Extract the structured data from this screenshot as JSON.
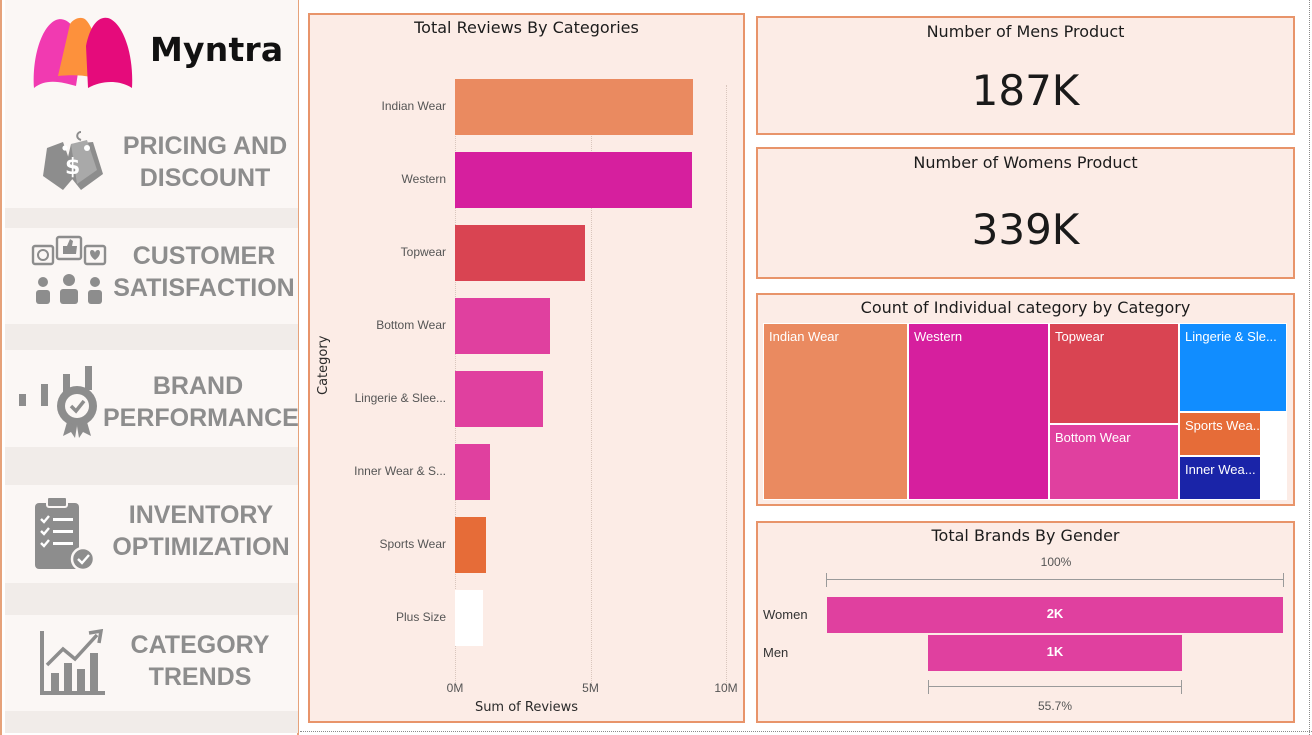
{
  "brand": {
    "name": "Myntra",
    "logo_colors": [
      "#f13ab1",
      "#fd913c",
      "#e50b7b"
    ]
  },
  "sidebar": {
    "items": [
      {
        "line1": "PRICING AND",
        "line2": "DISCOUNT",
        "icon": "price-tag-icon"
      },
      {
        "line1": "CUSTOMER",
        "line2": "SATISFACTION",
        "icon": "customer-feedback-icon"
      },
      {
        "line1": "BRAND",
        "line2": "PERFORMANCE",
        "icon": "brand-award-icon"
      },
      {
        "line1": "INVENTORY",
        "line2": "OPTIMIZATION",
        "icon": "clipboard-check-icon"
      },
      {
        "line1": "CATEGORY",
        "line2": "TRENDS",
        "icon": "trend-chart-icon"
      }
    ],
    "label_color": "#8d8d8d"
  },
  "cards": {
    "mens": {
      "title": "Number of Mens Product",
      "value": "187K"
    },
    "womens": {
      "title": "Number of Womens Product",
      "value": "339K"
    }
  },
  "chart_data": [
    {
      "type": "bar",
      "orientation": "horizontal",
      "title": "Total Reviews By Categories",
      "xlabel": "Sum of Reviews",
      "ylabel": "Category",
      "categories": [
        "Indian Wear",
        "Western",
        "Topwear",
        "Bottom Wear",
        "Lingerie & Slee...",
        "Inner Wear & S...",
        "Sports Wear",
        "Plus Size"
      ],
      "values": [
        8.8,
        8.75,
        4.8,
        3.5,
        3.25,
        1.3,
        1.15,
        1.05
      ],
      "colors": [
        "#ea8a60",
        "#d61f9e",
        "#d94452",
        "#e0409f",
        "#e0409f",
        "#e0409f",
        "#e66c38",
        "#ffffff"
      ],
      "x_ticks": [
        "0M",
        "5M",
        "10M"
      ],
      "xlim": [
        0,
        10
      ],
      "unit": "M",
      "grid": true
    },
    {
      "type": "treemap",
      "title": "Count of Individual category by Category",
      "items": [
        {
          "label": "Indian Wear",
          "color": "#ea8a60"
        },
        {
          "label": "Western",
          "color": "#d61f9e"
        },
        {
          "label": "Topwear",
          "color": "#d94452"
        },
        {
          "label": "Bottom Wear",
          "color": "#e0409f"
        },
        {
          "label": "Lingerie & Sle...",
          "color": "#118dff"
        },
        {
          "label": "Sports Wea...",
          "color": "#e66c38"
        },
        {
          "label": "Inner Wea...",
          "color": "#1a24a8"
        }
      ]
    },
    {
      "type": "funnel",
      "title": "Total Brands By Gender",
      "categories": [
        "Women",
        "Men"
      ],
      "values": [
        2000,
        1114
      ],
      "value_labels": [
        "2K",
        "1K"
      ],
      "top_percent": "100%",
      "bottom_percent": "55.7%",
      "color": "#e0409f"
    }
  ]
}
